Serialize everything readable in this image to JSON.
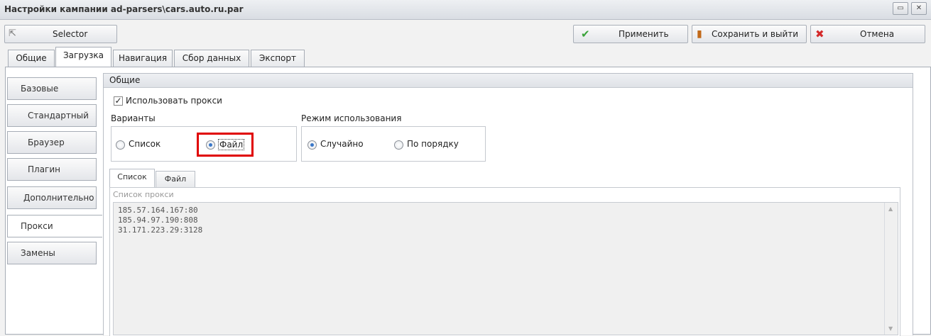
{
  "window": {
    "title": "Настройки кампании ad-parsers\\cars.auto.ru.par",
    "restore_icon": "restore-icon",
    "close_icon": "close-icon"
  },
  "toolbar": {
    "selector_label": "Selector",
    "apply_label": "Применить",
    "save_exit_label": "Сохранить и выйти",
    "cancel_label": "Отмена",
    "apply_color": "#3aa33a",
    "cancel_color": "#d42a2a"
  },
  "top_tabs": [
    "Общие",
    "Загрузка",
    "Навигация",
    "Сбор данных",
    "Экспорт"
  ],
  "active_top_tab": "Загрузка",
  "sidebar": {
    "items": [
      {
        "label": "Базовые"
      },
      {
        "label": "Стандартный"
      },
      {
        "label": "Браузер"
      },
      {
        "label": "Плагин"
      },
      {
        "label": "Дополнительно"
      },
      {
        "label": "Прокси"
      },
      {
        "label": "Замены"
      }
    ],
    "active": "Прокси"
  },
  "panel": {
    "title": "Общие",
    "use_proxy_label": "Использовать прокси",
    "use_proxy_checked": true,
    "variants": {
      "label": "Варианты",
      "options": [
        "Список",
        "Файл"
      ],
      "selected": "Файл"
    },
    "mode": {
      "label": "Режим использования",
      "options": [
        "Случайно",
        "По порядку"
      ],
      "selected": "Случайно"
    },
    "sub_tabs": [
      "Список",
      "Файл"
    ],
    "active_sub_tab": "Список",
    "proxy_list_label": "Список прокси",
    "proxy_list": [
      "185.57.164.167:80",
      "185.94.97.190:808",
      "31.171.223.29:3128"
    ]
  },
  "highlight_color": "#e00000"
}
